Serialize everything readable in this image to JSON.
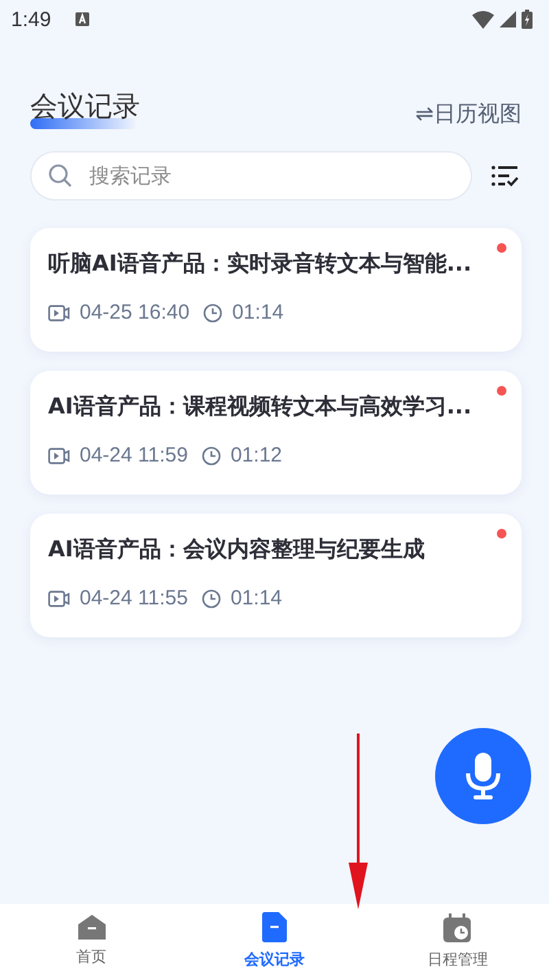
{
  "status_bar": {
    "time": "1:49"
  },
  "header": {
    "title": "会议记录",
    "switch_label": "⇌日历视图"
  },
  "search": {
    "placeholder": "搜索记录"
  },
  "records": [
    {
      "title": "听脑AI语音产品：实时录音转文本与智能...",
      "date": "04-25 16:40",
      "duration": "01:14",
      "unread": true
    },
    {
      "title": "AI语音产品：课程视频转文本与高效学习...",
      "date": "04-24 11:59",
      "duration": "01:12",
      "unread": true
    },
    {
      "title": "AI语音产品：会议内容整理与纪要生成",
      "date": "04-24 11:55",
      "duration": "01:14",
      "unread": true
    }
  ],
  "tabs": [
    {
      "label": "首页",
      "kind": "home",
      "selected": false
    },
    {
      "label": "会议记录",
      "kind": "records",
      "selected": true
    },
    {
      "label": "日程管理",
      "kind": "schedule",
      "selected": false
    }
  ]
}
